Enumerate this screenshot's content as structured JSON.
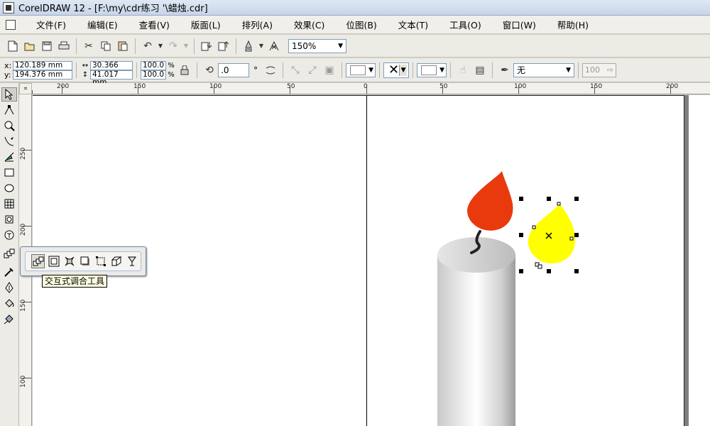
{
  "window": {
    "title": "CorelDRAW 12 - [F:\\my\\cdr练习  '\\蜡烛.cdr]"
  },
  "menu": [
    "文件(F)",
    "编辑(E)",
    "查看(V)",
    "版面(L)",
    "排列(A)",
    "效果(C)",
    "位图(B)",
    "文本(T)",
    "工具(O)",
    "窗口(W)",
    "帮助(H)"
  ],
  "toolbar": {
    "zoom": "150%"
  },
  "property_bar": {
    "x_label": "x:",
    "x_value": "120.189 mm",
    "y_label": "y:",
    "y_value": "194.376 mm",
    "width_value": "30.366 mm",
    "height_value": "41.017 mm",
    "scale_x": "100.0",
    "scale_y": "100.0",
    "percent": "%",
    "angle_value": ".0",
    "degree": "°",
    "outline_select": "无",
    "disabled_value": "100"
  },
  "rulers": {
    "h_labels": [
      "200",
      "150",
      "100",
      "50",
      "0",
      "50",
      "100",
      "150",
      "200"
    ],
    "v_labels": [
      "250",
      "200",
      "150",
      "100"
    ]
  },
  "flyout": {
    "tooltip": "交互式调合工具"
  },
  "colors": {
    "flame_red": "#e83a0c",
    "flame_yellow": "#ffff00",
    "wick": "#222222"
  }
}
